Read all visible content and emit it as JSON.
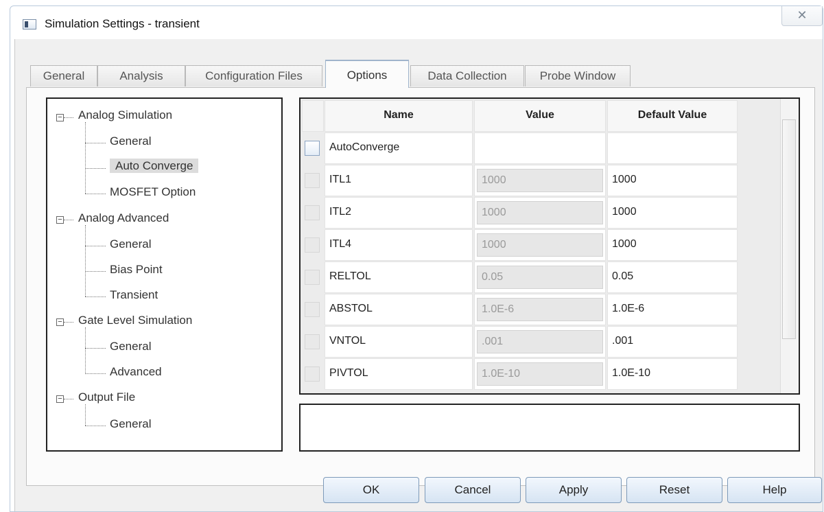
{
  "window": {
    "title": "Simulation Settings - transient",
    "close_glyph": "✕"
  },
  "tabs": [
    {
      "label": "General",
      "active": false
    },
    {
      "label": "Analysis",
      "active": false
    },
    {
      "label": "Configuration Files",
      "active": false
    },
    {
      "label": "Options",
      "active": true
    },
    {
      "label": "Data Collection",
      "active": false
    },
    {
      "label": "Probe Window",
      "active": false
    }
  ],
  "tree": {
    "groups": [
      {
        "label": "Analog Simulation",
        "expanded": true,
        "children": [
          "General",
          "Auto Converge",
          "MOSFET Option"
        ]
      },
      {
        "label": "Analog Advanced",
        "expanded": true,
        "children": [
          "General",
          "Bias Point",
          "Transient"
        ]
      },
      {
        "label": "Gate Level Simulation",
        "expanded": true,
        "children": [
          "General",
          "Advanced"
        ]
      },
      {
        "label": "Output File",
        "expanded": true,
        "children": [
          "General"
        ]
      }
    ],
    "selected": "Auto Converge",
    "expander_glyph": "−"
  },
  "grid": {
    "headers": {
      "name": "Name",
      "value": "Value",
      "default": "Default Value"
    },
    "rows": [
      {
        "name": "AutoConverge",
        "value": "",
        "default": "",
        "checkbox_enabled": true
      },
      {
        "name": "ITL1",
        "value": "1000",
        "default": "1000",
        "checkbox_enabled": false
      },
      {
        "name": "ITL2",
        "value": "1000",
        "default": "1000",
        "checkbox_enabled": false
      },
      {
        "name": "ITL4",
        "value": "1000",
        "default": "1000",
        "checkbox_enabled": false
      },
      {
        "name": "RELTOL",
        "value": "0.05",
        "default": "0.05",
        "checkbox_enabled": false
      },
      {
        "name": "ABSTOL",
        "value": "1.0E-6",
        "default": "1.0E-6",
        "checkbox_enabled": false
      },
      {
        "name": "VNTOL",
        "value": ".001",
        "default": ".001",
        "checkbox_enabled": false
      },
      {
        "name": "PIVTOL",
        "value": "1.0E-10",
        "default": "1.0E-10",
        "checkbox_enabled": false
      }
    ]
  },
  "description": "",
  "buttons": {
    "ok": "OK",
    "cancel": "Cancel",
    "apply": "Apply",
    "reset": "Reset",
    "help": "Help"
  }
}
